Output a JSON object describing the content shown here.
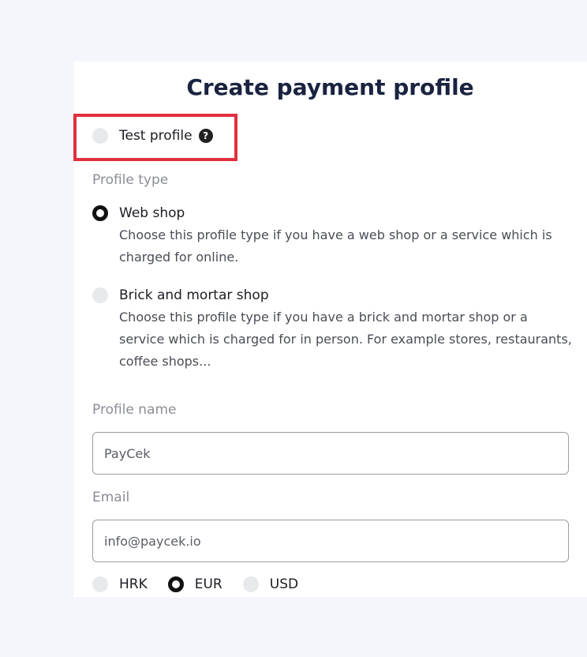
{
  "form": {
    "title": "Create payment profile",
    "test_profile_label": "Test profile",
    "help_glyph": "?",
    "profile_type_label": "Profile type",
    "options": [
      {
        "label": "Web shop",
        "description": "Choose this profile type if you have a web shop or a service which is charged for online.",
        "selected": true
      },
      {
        "label": "Brick and mortar shop",
        "description": "Choose this profile type if you have a brick and mortar shop or a service which is charged for in person. For example stores, restaurants, coffee shops...",
        "selected": false
      }
    ],
    "profile_name_label": "Profile name",
    "profile_name_value": "PayCek",
    "email_label": "Email",
    "email_value": "info@paycek.io",
    "currencies": [
      {
        "label": "HRK",
        "selected": false
      },
      {
        "label": "EUR",
        "selected": true
      },
      {
        "label": "USD",
        "selected": false
      }
    ]
  },
  "colors": {
    "highlight": "#e0303f",
    "title": "#1a2340",
    "background": "#f4f6fb"
  }
}
